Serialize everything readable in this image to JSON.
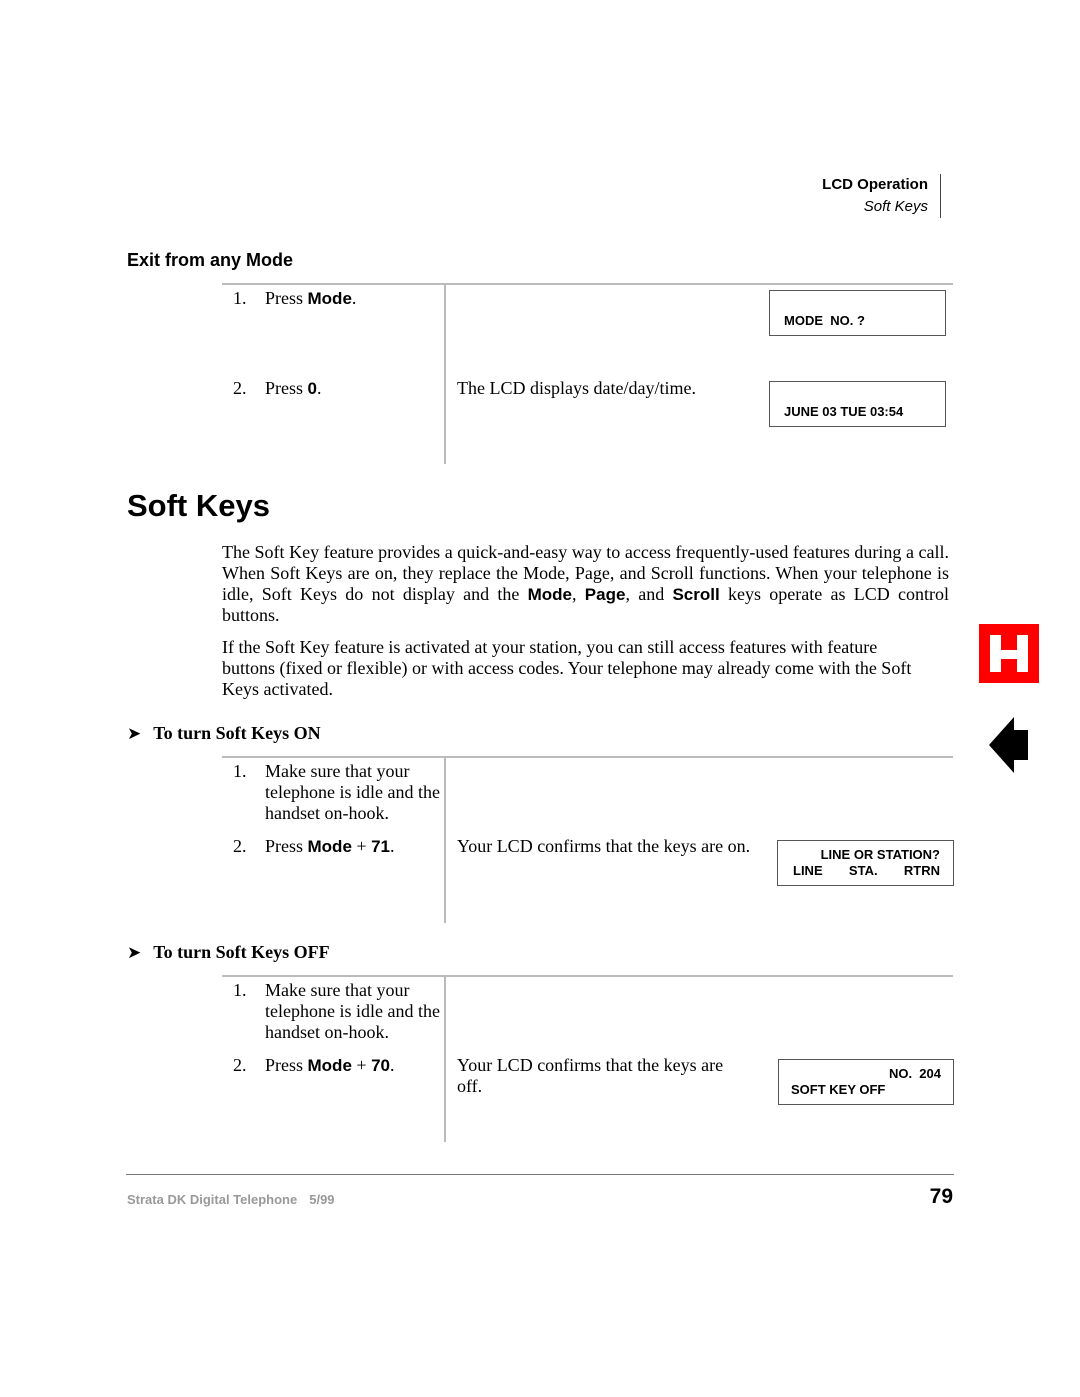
{
  "running_header": {
    "chapter": "LCD Operation",
    "section": "Soft Keys"
  },
  "exit_section": {
    "heading": "Exit from any Mode",
    "steps": [
      {
        "num": "1.",
        "pre": "Press ",
        "key": "Mode",
        "post": ".",
        "result": "",
        "lcd": [
          "MODE  NO. ?"
        ]
      },
      {
        "num": "2.",
        "pre": "Press ",
        "key": "0",
        "post": ".",
        "result": "The LCD displays date/day/time.",
        "lcd": [
          "JUNE 03 TUE 03:54"
        ]
      }
    ]
  },
  "soft_keys": {
    "title": "Soft Keys",
    "paragraph1": {
      "text_a": "The Soft Key feature provides a quick-and-easy way to access frequently-used features during a call. When Soft Keys are on, they replace the Mode, Page, and Scroll functions. When your telephone is idle, Soft Keys do not display and the ",
      "key1": "Mode",
      "sep1": ", ",
      "key2": "Page",
      "sep2": ", and ",
      "key3": "Scroll",
      "text_b": " keys operate as LCD control buttons."
    },
    "paragraph2": "If the Soft Key feature is activated at your station, you can still access features with feature buttons (fixed or flexible) or with access codes. Your telephone may already come with the Soft Keys activated."
  },
  "procedures": [
    {
      "arrow": "➤",
      "heading": "To turn Soft Keys ON",
      "steps": [
        {
          "num": "1.",
          "text": "Make sure that your telephone is idle and the handset on-hook."
        },
        {
          "num": "2.",
          "pre": "Press ",
          "key": "Mode",
          "mid": " + ",
          "key2": "71",
          "post": ".",
          "result": "Your LCD confirms that the keys are on.",
          "lcd": {
            "line1": "LINE OR STATION?",
            "line2": [
              "LINE",
              "STA.",
              "RTRN"
            ]
          }
        }
      ]
    },
    {
      "arrow": "➤",
      "heading": "To turn Soft Keys OFF",
      "steps": [
        {
          "num": "1.",
          "text": "Make sure that your telephone is idle and the handset on-hook."
        },
        {
          "num": "2.",
          "pre": "Press ",
          "key": "Mode",
          "mid": " + ",
          "key2": "70",
          "post": ".",
          "result": "Your LCD confirms that the keys are off.",
          "lcd": {
            "line1": "NO.  204",
            "line2": "SOFT KEY OFF"
          }
        }
      ]
    }
  ],
  "side_tab": {
    "letter": "H",
    "color": "#ff0000"
  },
  "footer": {
    "book": "Strata DK Digital Telephone",
    "date": "5/99",
    "page": "79"
  }
}
